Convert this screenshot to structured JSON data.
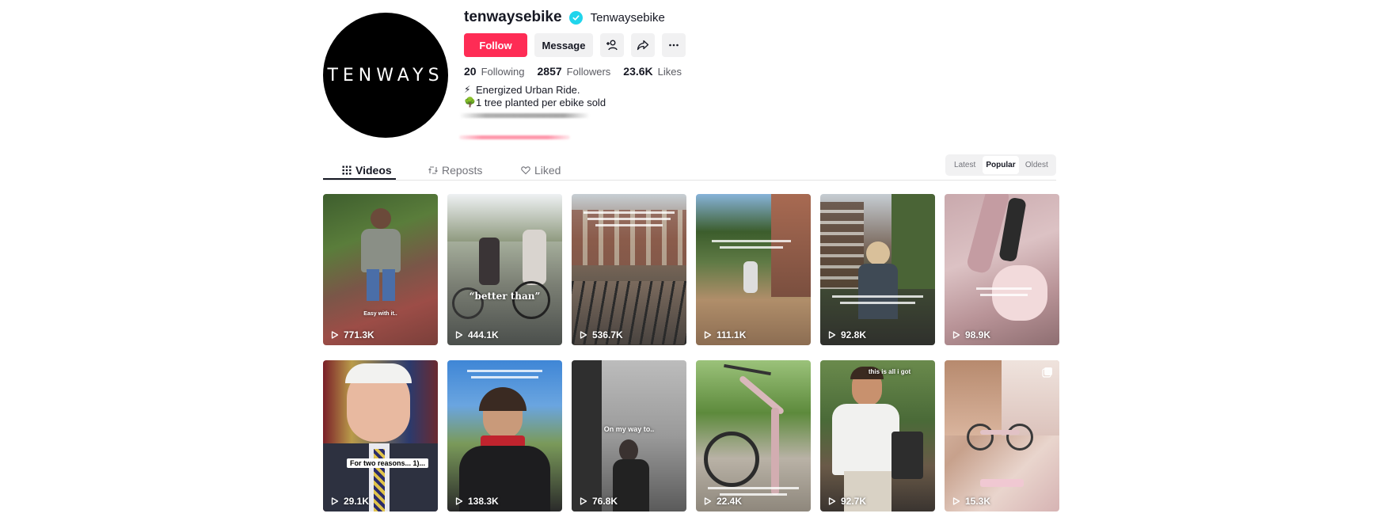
{
  "profile": {
    "avatar_text": "TENWAYS",
    "username": "tenwaysebike",
    "nickname": "Tenwaysebike",
    "follow_label": "Follow",
    "message_label": "Message",
    "stats": {
      "following_count": "20",
      "following_label": "Following",
      "followers_count": "2857",
      "followers_label": "Followers",
      "likes_count": "23.6K",
      "likes_label": "Likes"
    },
    "bio": [
      {
        "emoji": "⚡",
        "text": "Energized Urban Ride."
      },
      {
        "emoji": "🌳",
        "text": "1 tree planted per ebike sold"
      }
    ]
  },
  "tabs": [
    {
      "label": "Videos",
      "icon": "grid-icon",
      "active": true
    },
    {
      "label": "Reposts",
      "icon": "repost-icon",
      "active": false
    },
    {
      "label": "Liked",
      "icon": "heart-icon",
      "active": false
    }
  ],
  "sort": {
    "options": [
      "Latest",
      "Popular",
      "Oldest"
    ],
    "selected": "Popular"
  },
  "videos": [
    {
      "views": "771.3K",
      "caption": "Easy with it..",
      "scene": "park"
    },
    {
      "views": "444.1K",
      "caption": "“better than”",
      "scene": "street"
    },
    {
      "views": "536.7K",
      "caption": "",
      "scene": "parking"
    },
    {
      "views": "111.1K",
      "caption": "",
      "scene": "avenue"
    },
    {
      "views": "92.8K",
      "caption": "",
      "scene": "canal"
    },
    {
      "views": "98.9K",
      "caption": "",
      "scene": "pink"
    },
    {
      "views": "29.1K",
      "caption": "For two reasons... 1)...",
      "scene": "portrait"
    },
    {
      "views": "138.3K",
      "caption": "",
      "scene": "sky"
    },
    {
      "views": "76.8K",
      "caption": "On my way to..",
      "scene": "dark"
    },
    {
      "views": "22.4K",
      "caption": "",
      "scene": "garden"
    },
    {
      "views": "92.7K",
      "caption": "this is all i got",
      "scene": "man"
    },
    {
      "views": "15.3K",
      "caption": "",
      "scene": "collage"
    }
  ],
  "colors": {
    "accent": "#fe2c55",
    "verified": "#20d5ec",
    "text": "#161823",
    "muted": "#73747b"
  }
}
